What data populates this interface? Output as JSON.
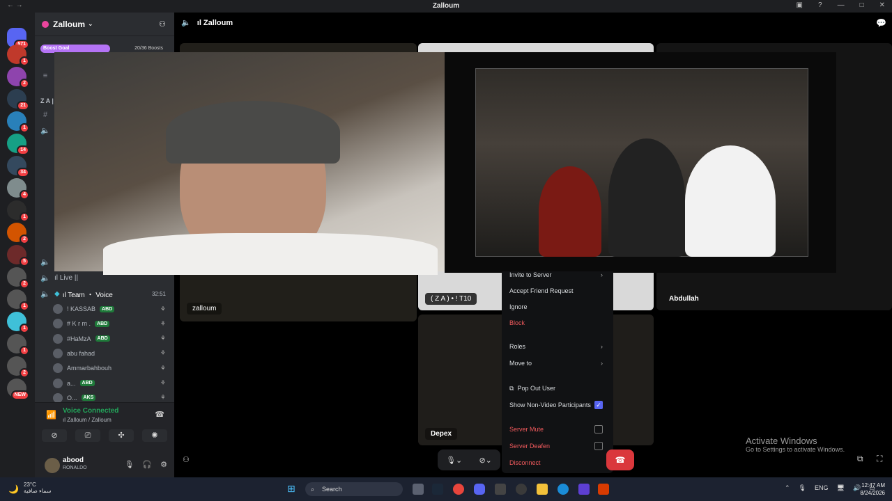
{
  "window": {
    "title": "Zalloum",
    "nav": "← →"
  },
  "guilds": {
    "home_badge": "571",
    "items": [
      {
        "badge": "1",
        "color": "#c0392b"
      },
      {
        "badge": "2",
        "color": "#8e44ad"
      },
      {
        "badge": "21",
        "color": "#2c3e50"
      },
      {
        "badge": "1",
        "color": "#2980b9"
      },
      {
        "badge": "14",
        "color": "#16a085"
      },
      {
        "badge": "34",
        "color": "#34495e"
      },
      {
        "badge": "4",
        "color": "#7f8c8d"
      },
      {
        "badge": "1",
        "color": "#2c2c2c"
      },
      {
        "badge": "2",
        "color": "#d35400"
      },
      {
        "badge": "5",
        "color": "#6d2a2a"
      },
      {
        "badge": "2",
        "color": "#555"
      },
      {
        "badge": "1",
        "color": "#555"
      },
      {
        "badge": "1",
        "color": "#3fc0d8"
      },
      {
        "badge": "1",
        "color": "#555"
      },
      {
        "badge": "2",
        "color": "#555"
      },
      {
        "badge": "NEW",
        "color": "#555"
      }
    ]
  },
  "server": {
    "name": "Zalloum",
    "boost_label": "Boost Goal",
    "boost_count": "20/36 Boosts",
    "abbr": "Z A |"
  },
  "channels": {
    "live": "ıl Live ||",
    "team_voice": "ıl Team ・ Voice",
    "team_timer": "32:51",
    "members": [
      {
        "name": "! KASSAB",
        "tag": "ABD"
      },
      {
        "name": "# K r m .",
        "tag": "ABD"
      },
      {
        "name": "#HaMzA",
        "tag": "ABD"
      },
      {
        "name": "abu fahad",
        "tag": ""
      },
      {
        "name": "Ammarbahbouh",
        "tag": ""
      },
      {
        "name": "a...",
        "tag": "ABD"
      },
      {
        "name": "O...",
        "tag": "AKS"
      }
    ]
  },
  "voice": {
    "status": "Voice Connected",
    "location": "ıl Zalloum / Zalloum"
  },
  "user": {
    "name": "abood",
    "status": "RONALDO"
  },
  "stage": {
    "header": "ıl Zalloum",
    "tiles": {
      "zalloum": "zalloum",
      "za": "( Z A ) • ! T10",
      "abdullah": "Abdullah",
      "depex": "Depex"
    }
  },
  "menu": {
    "invite": "Invite to Server",
    "accept": "Accept Friend Request",
    "ignore": "Ignore",
    "block": "Block",
    "roles": "Roles",
    "move": "Move to",
    "popout": "Pop Out User",
    "show_non_video": "Show Non-Video Participants",
    "server_mute": "Server Mute",
    "server_deafen": "Server Deafen",
    "disconnect": "Disconnect"
  },
  "activate": {
    "title": "Activate Windows",
    "sub": "Go to Settings to activate Windows."
  },
  "taskbar": {
    "temp": "23°C",
    "weather": "سماء صافية",
    "search": "Search",
    "lang": "ENG",
    "time": "12:47 AM",
    "date": "8/24/2026"
  }
}
